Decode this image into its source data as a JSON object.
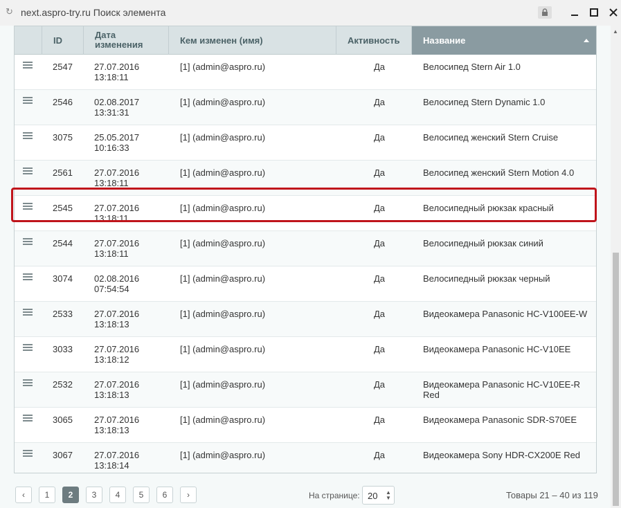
{
  "window": {
    "url": "next.aspro-try.ru",
    "title": "Поиск элемента"
  },
  "table": {
    "headers": {
      "id": "ID",
      "date": "Дата изменения",
      "user": "Кем изменен (имя)",
      "active": "Активность",
      "name": "Название"
    },
    "rows": [
      {
        "id": "2547",
        "date1": "27.07.2016",
        "date2": "13:18:11",
        "user": "[1] (admin@aspro.ru)",
        "active": "Да",
        "name": "Велосипед Stern Air 1.0"
      },
      {
        "id": "2546",
        "date1": "02.08.2017",
        "date2": "13:31:31",
        "user": "[1] (admin@aspro.ru)",
        "active": "Да",
        "name": "Велосипед Stern Dynamic 1.0"
      },
      {
        "id": "3075",
        "date1": "25.05.2017",
        "date2": "10:16:33",
        "user": "[1] (admin@aspro.ru)",
        "active": "Да",
        "name": "Велосипед женский Stern Cruise"
      },
      {
        "id": "2561",
        "date1": "27.07.2016",
        "date2": "13:18:11",
        "user": "[1] (admin@aspro.ru)",
        "active": "Да",
        "name": "Велосипед женский Stern Motion 4.0"
      },
      {
        "id": "2545",
        "date1": "27.07.2016",
        "date2": "13:18:11",
        "user": "[1] (admin@aspro.ru)",
        "active": "Да",
        "name": "Велосипедный рюкзак красный"
      },
      {
        "id": "2544",
        "date1": "27.07.2016",
        "date2": "13:18:11",
        "user": "[1] (admin@aspro.ru)",
        "active": "Да",
        "name": "Велосипедный рюкзак синий"
      },
      {
        "id": "3074",
        "date1": "02.08.2016",
        "date2": "07:54:54",
        "user": "[1] (admin@aspro.ru)",
        "active": "Да",
        "name": "Велосипедный рюкзак черный"
      },
      {
        "id": "2533",
        "date1": "27.07.2016",
        "date2": "13:18:13",
        "user": "[1] (admin@aspro.ru)",
        "active": "Да",
        "name": "Видеокамера Panasonic HC-V100EE-W"
      },
      {
        "id": "3033",
        "date1": "27.07.2016",
        "date2": "13:18:12",
        "user": "[1] (admin@aspro.ru)",
        "active": "Да",
        "name": "Видеокамера Panasonic HC-V10EE"
      },
      {
        "id": "2532",
        "date1": "27.07.2016",
        "date2": "13:18:13",
        "user": "[1] (admin@aspro.ru)",
        "active": "Да",
        "name": "Видеокамера Panasonic HC-V10EE-R Red"
      },
      {
        "id": "3065",
        "date1": "27.07.2016",
        "date2": "13:18:13",
        "user": "[1] (admin@aspro.ru)",
        "active": "Да",
        "name": "Видеокамера Panasonic SDR-S70EE"
      },
      {
        "id": "3067",
        "date1": "27.07.2016",
        "date2": "13:18:14",
        "user": "[1] (admin@aspro.ru)",
        "active": "Да",
        "name": "Видеокамера Sony HDR-CX200E Red"
      }
    ],
    "highlighted_row_id": "2545"
  },
  "pagination": {
    "prev_label": "‹",
    "next_label": "›",
    "pages": [
      "1",
      "2",
      "3",
      "4",
      "5",
      "6"
    ],
    "current_page": "2",
    "per_page_label": "На странице:",
    "per_page_value": "20",
    "total_text": "Товары 21 – 40 из 119"
  },
  "colors": {
    "highlight": "#c0141b",
    "sorted_header": "#8a9ba1"
  }
}
